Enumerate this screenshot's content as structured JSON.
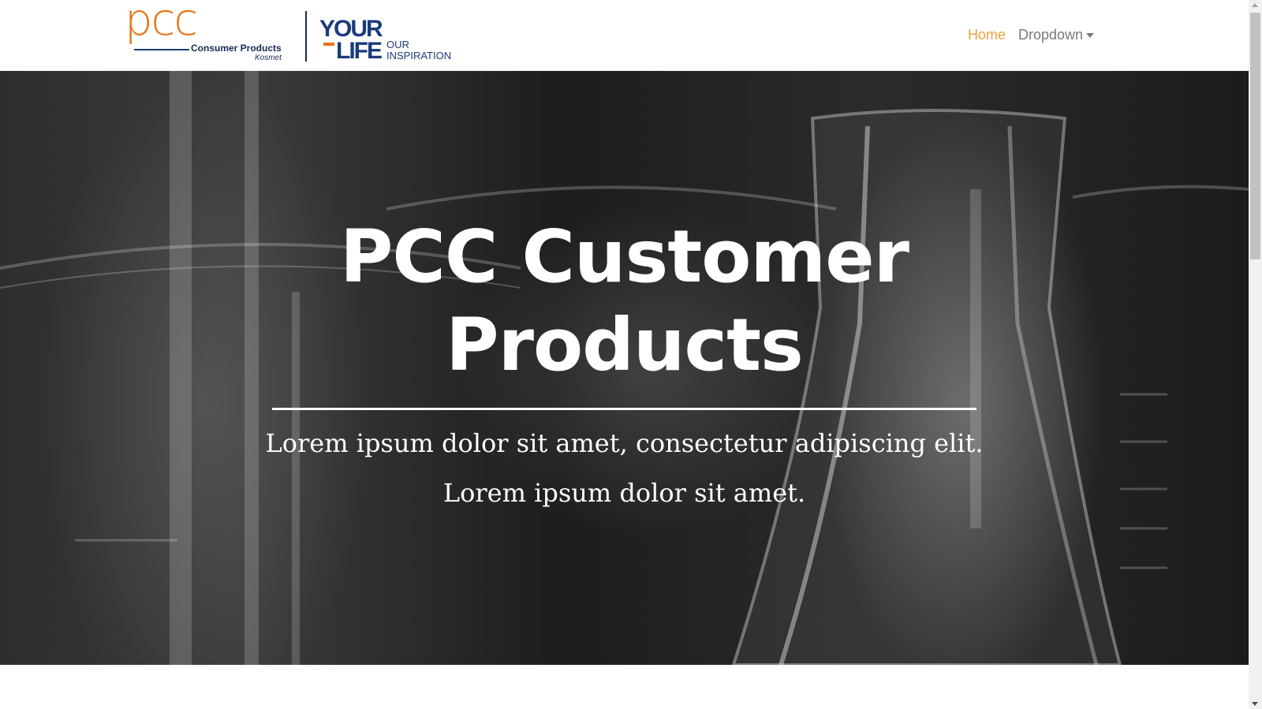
{
  "brand": {
    "pcc": "pcc",
    "consumer_products": "Consumer Products",
    "kosmet": "Kosmet",
    "your": "YOUR",
    "life": "LIFE",
    "our": "OUR",
    "inspiration": "INSPIRATION"
  },
  "nav": {
    "home": "Home",
    "dropdown": "Dropdown"
  },
  "hero": {
    "title": "PCC Customer Products",
    "subtitle_line1": "Lorem ipsum dolor sit amet, consectetur adipiscing elit.",
    "subtitle_line2": "Lorem ipsum dolor sit amet."
  },
  "colors": {
    "accent_orange": "#e8751a",
    "active_link": "#e8a33c",
    "brand_navy": "#1b3b79",
    "nav_link": "#7a7a7a"
  }
}
